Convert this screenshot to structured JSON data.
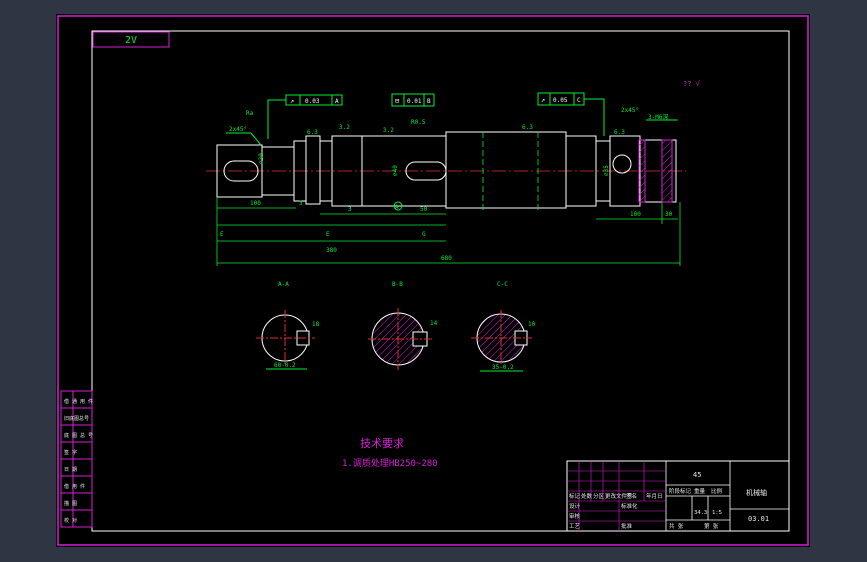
{
  "sheet": {
    "revision_tag": "2V",
    "roughness_note": "?? √"
  },
  "drawing": {
    "tolerance_frames": [
      {
        "symbol": "↗",
        "value": "0.03",
        "datum": "A"
      },
      {
        "symbol": "⊟",
        "value": "0.01",
        "datum": "B"
      },
      {
        "symbol": "↗",
        "value": "0.05",
        "datum": "C"
      }
    ],
    "leader_notes": {
      "chamfer_left": "2x45°",
      "chamfer_right": "2x45°",
      "thread_note": "3-M6深",
      "tip": "Ra",
      "right_tip": "R0.5"
    },
    "roughness_marks": [
      "6.3",
      "3.2",
      "3.2",
      "6.3",
      "6.3"
    ],
    "dimensions": {
      "left_key_length": "100",
      "left_step": "3",
      "center_key": "50",
      "center_gap": "3",
      "right_key_length": "100",
      "right_end": "30",
      "overall_left": "E",
      "overall_mid": "E",
      "overall_right": "G",
      "total_length": "380",
      "overall_length": "680",
      "diam_small": "∅30",
      "diam_mid": "∅40",
      "diam_right": "∅35"
    },
    "datum_label": "A"
  },
  "sections": [
    {
      "title": "A-A",
      "bottom_dim": "60-0.2",
      "side_dim": "18"
    },
    {
      "title": "B-B",
      "bottom_dim": "",
      "side_dim": "14"
    },
    {
      "title": "C-C",
      "bottom_dim": "35-0.2",
      "side_dim": "10"
    }
  ],
  "tech_requirements": {
    "title": "技术要求",
    "line1": "1.调质处理HB250~280"
  },
  "left_stamp": {
    "rows": [
      "借 通 用 件",
      "旧底图总号",
      "底 图 总 号",
      "签    字",
      "日    期",
      "借 用 件",
      "描    图",
      "校    对"
    ]
  },
  "title_block": {
    "material": "45",
    "part_name": "机械轴",
    "drawing_number": "03.01",
    "labels": {
      "mark": "标记",
      "count": "处数",
      "zone": "分区",
      "change_doc": "更改文件号",
      "signature": "签名",
      "date": "年月日",
      "designer": "设计",
      "standardize": "标准化",
      "review": "审核",
      "process": "工艺",
      "approve": "批准",
      "stage_mark": "阶段标记",
      "weight": "重量",
      "scale": "比例",
      "sheets": "共 张",
      "sheet_no": "第 张",
      "weight_val": "34.3",
      "scale_val": "1:5"
    }
  },
  "colors": {
    "frame": "#d61fd6",
    "geometry": "#ffffff",
    "dimension": "#00ee33",
    "hatch": "#d61fd6",
    "center": "#e03030",
    "title_text": "#e8e8e8"
  }
}
